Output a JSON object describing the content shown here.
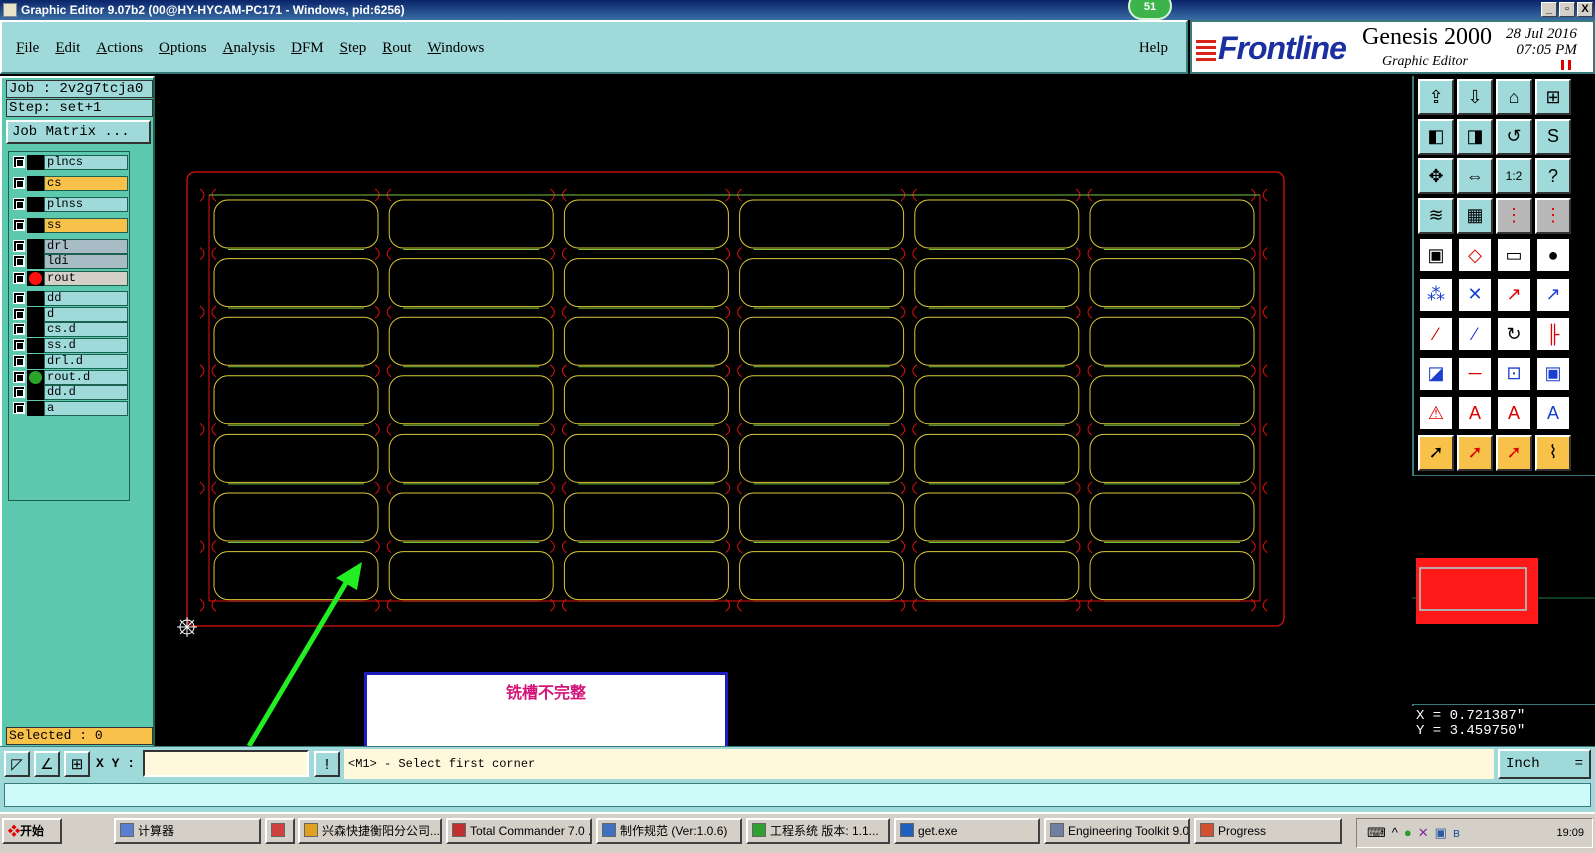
{
  "window": {
    "title": "Graphic Editor 9.07b2 (00@HY-HYCAM-PC171 - Windows, pid:6256)",
    "badge": "51",
    "buttons": [
      "_",
      "▫",
      "X"
    ]
  },
  "menu": {
    "items": [
      "File",
      "Edit",
      "Actions",
      "Options",
      "Analysis",
      "DFM",
      "Step",
      "Rout",
      "Windows"
    ],
    "help": "Help"
  },
  "logo": {
    "brand": "Frontline",
    "product": "Genesis 2000",
    "subtitle": "Graphic Editor",
    "date": "28 Jul 2016",
    "time": "07:05 PM"
  },
  "left": {
    "job": "Job : 2v2g7tcja0",
    "step": "Step: set+1",
    "job_matrix": "Job Matrix ...",
    "layers": [
      {
        "name": "plncs",
        "color": "#9fd9d9",
        "marker": ""
      },
      {
        "name": "cs",
        "color": "#f7c14a",
        "marker": ""
      },
      {
        "name": "plnss",
        "color": "#9fd9d9",
        "marker": ""
      },
      {
        "name": "ss",
        "color": "#f7c14a",
        "marker": ""
      },
      {
        "name": "drl",
        "color": "#a7bcc4",
        "marker": ""
      },
      {
        "name": "ldi",
        "color": "#a7bcc4",
        "marker": ""
      },
      {
        "name": "rout",
        "color": "#d4d0c8",
        "marker": "#ff1010"
      },
      {
        "name": "dd",
        "color": "#9fd9d9",
        "marker": ""
      },
      {
        "name": "d",
        "color": "#9fd9d9",
        "marker": ""
      },
      {
        "name": "cs.d",
        "color": "#9fd9d9",
        "marker": ""
      },
      {
        "name": "ss.d",
        "color": "#9fd9d9",
        "marker": ""
      },
      {
        "name": "drl.d",
        "color": "#9fd9d9",
        "marker": ""
      },
      {
        "name": "rout.d",
        "color": "#9fd9d9",
        "marker": "#2aa52a"
      },
      {
        "name": "dd.d",
        "color": "#9fd9d9",
        "marker": ""
      },
      {
        "name": "a",
        "color": "#9fd9d9",
        "marker": ""
      }
    ],
    "selected": "Selected : 0"
  },
  "canvas": {
    "note": "铣槽不完整"
  },
  "coords": {
    "x": "X = 0.721387\"",
    "y": "Y = 3.459750\""
  },
  "command": {
    "xy_label": "X Y :",
    "xy_value": "",
    "prompt": "<M1> - Select first corner",
    "unit": "Inch",
    "unit_icon": "="
  },
  "taskbar": {
    "start": "开始",
    "tasks": [
      "计算器",
      "",
      "兴森快捷衡阳分公司...",
      "Total Commander 7.0 ...",
      "制作规范 (Ver:1.0.6)",
      "工程系统  版本: 1.1...",
      "get.exe",
      "Engineering Toolkit 9.0...",
      "Progress"
    ],
    "clock": "19:09"
  },
  "colors": {
    "panel": "#9fd9d9",
    "layer_panel": "#5cc9ae",
    "rout_red": "#e01010",
    "slot_yellow": "#d8c83a",
    "slot_green": "#7ac43a"
  }
}
